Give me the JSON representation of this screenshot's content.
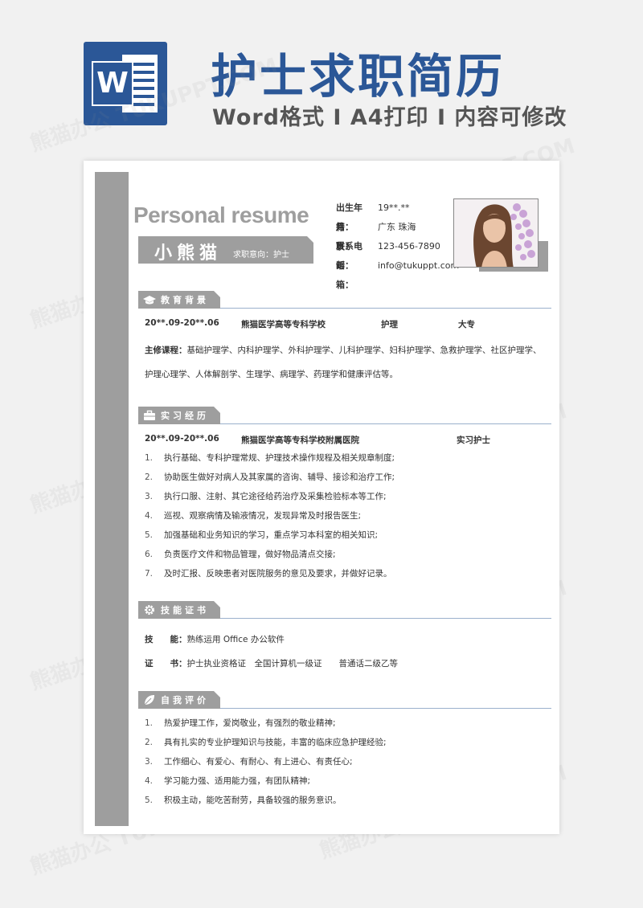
{
  "banner": {
    "logo_letter": "W",
    "title": "护士求职简历",
    "subtitle": "Word格式 I A4打印 I 内容可修改"
  },
  "watermark": "熊猫办公 TUKUPPT.COM",
  "resume": {
    "heading": "Personal resume",
    "name": "小熊猫",
    "job_intent": "求职意向：护士",
    "info": [
      {
        "label": "出生年月：",
        "value": "19**.**"
      },
      {
        "label": "籍　　贯：",
        "value": "广东 珠海"
      },
      {
        "label": "联系电话：",
        "value": "123-456-7890"
      },
      {
        "label": "邮　　箱：",
        "value": "info@tukuppt.com"
      }
    ],
    "education": {
      "title": "教育背景",
      "period": "20**.09-20**.06",
      "school": "熊猫医学高等专科学校",
      "major": "护理",
      "degree": "大专",
      "courses_label": "主修课程：",
      "courses_line1": "基础护理学、内科护理学、外科护理学、儿科护理学、妇科护理学、急救护理学、社区护理学、",
      "courses_line2": "护理心理学、人体解剖学、生理学、病理学、药理学和健康评估等。"
    },
    "internship": {
      "title": "实习经历",
      "period": "20**.09-20**.06",
      "org": "熊猫医学高等专科学校附属医院",
      "role": "实习护士",
      "items": [
        {
          "n": "1.",
          "t": "执行基础、专科护理常规、护理技术操作规程及相关规章制度;"
        },
        {
          "n": "2.",
          "t": "协助医生做好对病人及其家属的咨询、辅导、接诊和治疗工作;"
        },
        {
          "n": "3.",
          "t": "执行口服、注射、其它途径给药治疗及采集检验标本等工作;"
        },
        {
          "n": "4.",
          "t": "巡视、观察病情及输液情况，发现异常及时报告医生;"
        },
        {
          "n": "5.",
          "t": "加强基础和业务知识的学习，重点学习本科室的相关知识;"
        },
        {
          "n": "6.",
          "t": "负责医疗文件和物品管理，做好物品清点交接;"
        },
        {
          "n": "7.",
          "t": "及时汇报、反映患者对医院服务的意见及要求，并做好记录。"
        }
      ]
    },
    "skills": {
      "title": "技能证书",
      "skill_label": "技　　能：",
      "skill_value": "熟练运用 Office 办公软件",
      "cert_label": "证　　书：",
      "cert_value": "护士执业资格证　全国计算机一级证　　普通话二级乙等"
    },
    "self_eval": {
      "title": "自我评价",
      "items": [
        {
          "n": "1.",
          "t": "热爱护理工作，爱岗敬业，有强烈的敬业精神;"
        },
        {
          "n": "2.",
          "t": "具有扎实的专业护理知识与技能，丰富的临床应急护理经验;"
        },
        {
          "n": "3.",
          "t": "工作细心、有爱心、有耐心、有上进心、有责任心;"
        },
        {
          "n": "4.",
          "t": "学习能力强、适用能力强，有团队精神;"
        },
        {
          "n": "5.",
          "t": "积极主动，能吃苦耐劳，具备较强的服务意识。"
        }
      ]
    }
  }
}
